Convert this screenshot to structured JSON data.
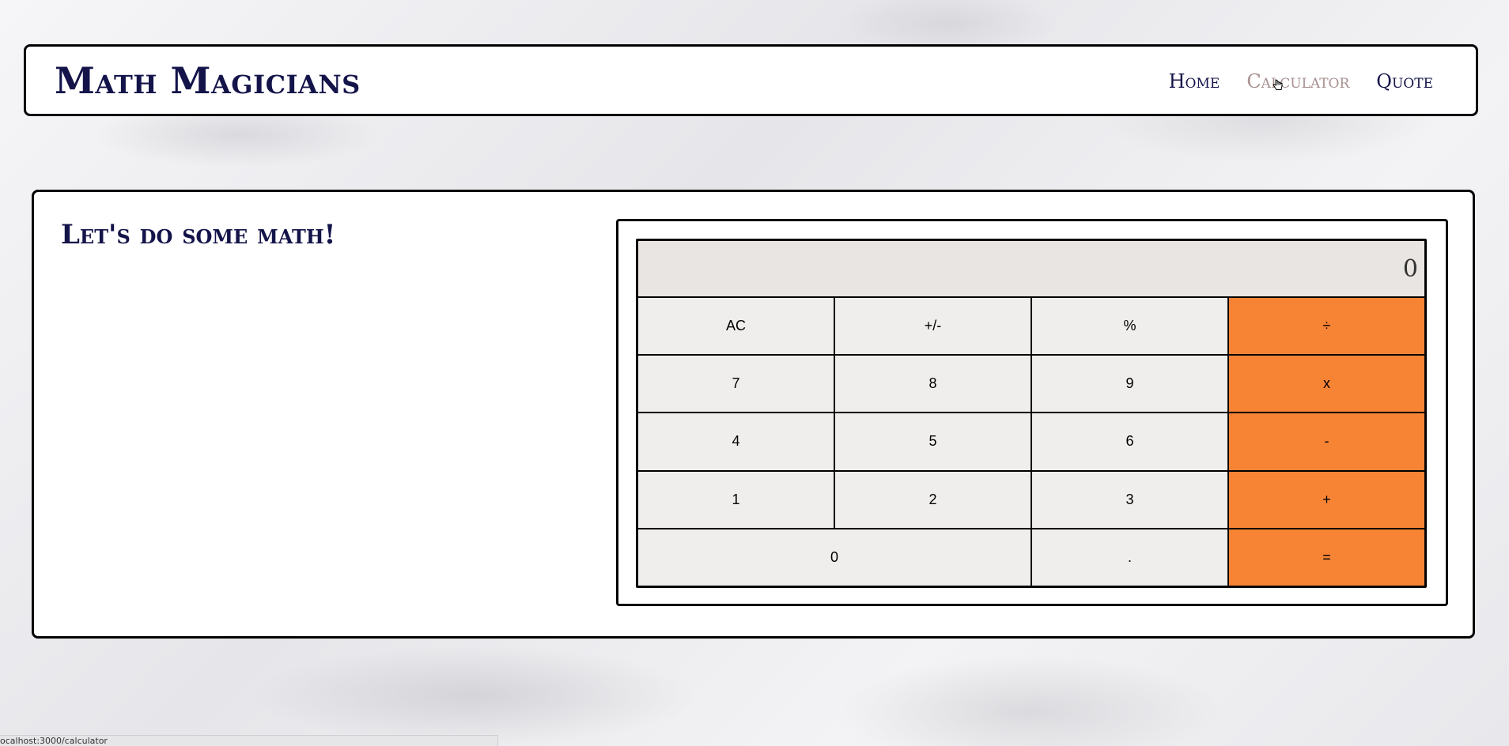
{
  "header": {
    "logo": "Math Magicians",
    "nav": [
      {
        "label": "Home"
      },
      {
        "label": "Calculator"
      },
      {
        "label": "Quote"
      }
    ]
  },
  "main": {
    "heading": "Let's do some math!"
  },
  "calculator": {
    "display": "0",
    "buttons": {
      "ac": "AC",
      "sign": "+/-",
      "percent": "%",
      "divide": "÷",
      "n7": "7",
      "n8": "8",
      "n9": "9",
      "multiply": "x",
      "n4": "4",
      "n5": "5",
      "n6": "6",
      "minus": "-",
      "n1": "1",
      "n2": "2",
      "n3": "3",
      "plus": "+",
      "n0": "0",
      "dot": ".",
      "equals": "="
    },
    "colors": {
      "operator": "#f68434",
      "key": "#efeeec",
      "display": "#e9e5e2"
    }
  },
  "status_bar": {
    "url": "ocalhost:3000/calculator"
  },
  "icons": {
    "cursor": "hand-pointer-icon"
  }
}
